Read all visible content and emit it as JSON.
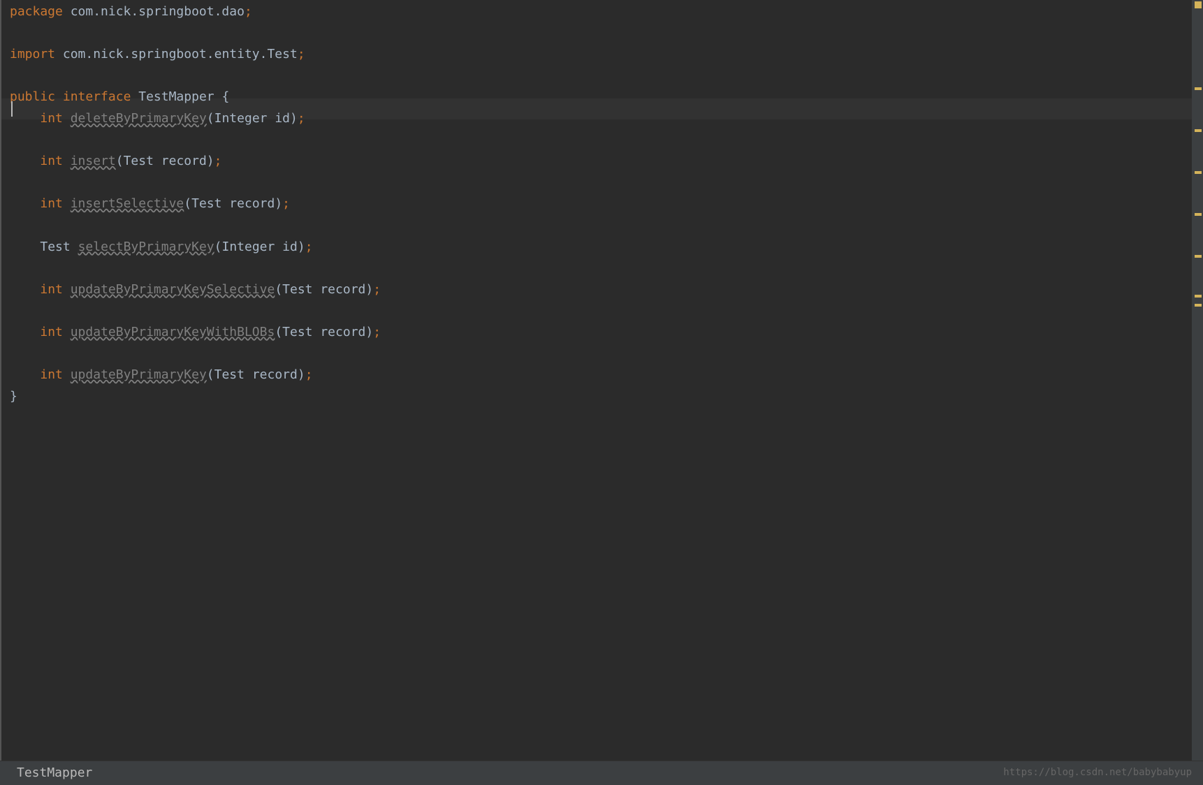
{
  "code": {
    "package_kw": "package",
    "package_name": " com.nick.springboot.dao",
    "semicolon": ";",
    "import_kw": "import",
    "import_name": " com.nick.springboot.entity.Test",
    "public_kw": "public",
    "interface_kw": " interface",
    "class_name": " TestMapper ",
    "open_brace": "{",
    "close_brace": "}",
    "indent": "    ",
    "int_kw": "int",
    "test_type": "Test",
    "m1_name": "deleteByPrimaryKey",
    "m1_params": "(Integer id)",
    "m2_name": "insert",
    "m2_params": "(Test record)",
    "m3_name": "insertSelective",
    "m3_params": "(Test record)",
    "m4_name": "selectByPrimaryKey",
    "m4_params": "(Integer id)",
    "m5_name": "updateByPrimaryKeySelective",
    "m5_params": "(Test record)",
    "m6_name": "updateByPrimaryKeyWithBLOBs",
    "m6_params": "(Test record)",
    "m7_name": "updateByPrimaryKey",
    "m7_params": "(Test record)"
  },
  "breadcrumb": {
    "label": "TestMapper"
  },
  "watermark": {
    "text": "https://blog.csdn.net/babybabyup"
  }
}
